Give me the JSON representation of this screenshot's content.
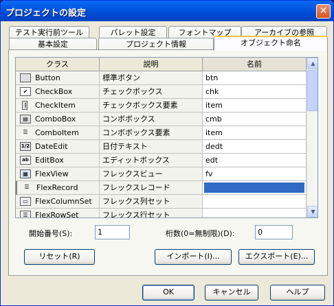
{
  "window": {
    "title": "プロジェクトの設定",
    "close_glyph": "✕"
  },
  "tabs_row1": [
    {
      "label": "テスト実行前ツール"
    },
    {
      "label": "パレット設定"
    },
    {
      "label": "フォントマップ"
    },
    {
      "label": "アーカイブの参照"
    }
  ],
  "tabs_row2": [
    {
      "label": "基本設定"
    },
    {
      "label": "プロジェクト情報"
    },
    {
      "label": "オブジェクト命名",
      "active": true
    }
  ],
  "grid": {
    "headers": {
      "class": "クラス",
      "description": "説明",
      "name": "名前"
    },
    "rows": [
      {
        "class": "Button",
        "description": "標準ボタン",
        "name": "btn",
        "icon": "button-icon",
        "glyph": ""
      },
      {
        "class": "CheckBox",
        "description": "チェックボックス",
        "name": "chk",
        "icon": "checkbox-icon",
        "glyph": "✔"
      },
      {
        "class": "CheckItem",
        "description": "チェックボックス要素",
        "name": "item",
        "icon": "checkitem-icon",
        "glyph": "⋮"
      },
      {
        "class": "ComboBox",
        "description": "コンボボックス",
        "name": "cmb",
        "icon": "combobox-icon",
        "glyph": "▤"
      },
      {
        "class": "ComboItem",
        "description": "コンボボックス要素",
        "name": "item",
        "icon": "comboitem-icon",
        "glyph": "☰"
      },
      {
        "class": "DateEdit",
        "description": "日付テキスト",
        "name": "dedt",
        "icon": "dateedit-icon",
        "glyph": "1/2"
      },
      {
        "class": "EditBox",
        "description": "エディットボックス",
        "name": "edt",
        "icon": "editbox-icon",
        "glyph": "ab"
      },
      {
        "class": "FlexView",
        "description": "フレックスビュー",
        "name": "fv",
        "icon": "flexview-icon",
        "glyph": "▦"
      },
      {
        "class": "FlexRecord",
        "description": "フレックスレコード",
        "name": "",
        "icon": "flexrecord-icon",
        "glyph": "☰",
        "selected": true
      },
      {
        "class": "FlexColumnSet",
        "description": "フレックス列セット",
        "name": "",
        "icon": "flexcolumnset-icon",
        "glyph": "▭"
      },
      {
        "class": "FlexRowSet",
        "description": "フレックス行セット",
        "name": "",
        "icon": "flexrowset-icon",
        "glyph": "☰"
      }
    ]
  },
  "start_number": {
    "label": "開始番号(S):",
    "value": "1"
  },
  "digits": {
    "label": "桁数(0=無制限)(D):",
    "value": "0"
  },
  "buttons": {
    "reset": "リセット(R)",
    "import": "インポート(I)...",
    "export": "エクスポート(E)...",
    "ok": "OK",
    "cancel": "キャンセル",
    "help": "ヘルプ"
  },
  "scrollbar": {
    "up_glyph": "▲",
    "down_glyph": "▼"
  }
}
